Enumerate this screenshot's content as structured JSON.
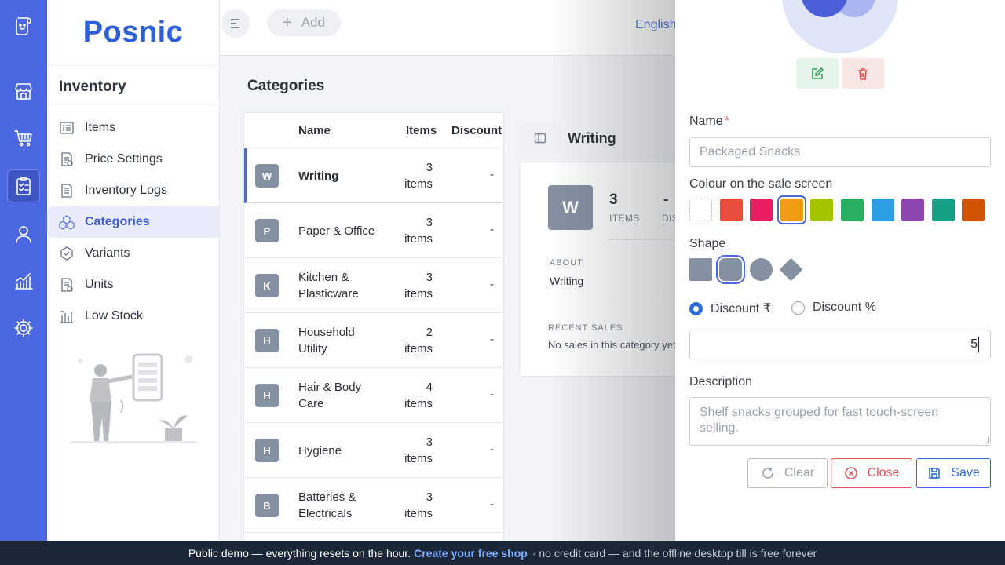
{
  "brand": "Posnic",
  "rail": [
    "store-icon",
    "cart-icon",
    "inventory-icon",
    "user-icon",
    "reports-icon",
    "settings-icon"
  ],
  "sidebar": {
    "title": "Inventory",
    "items": [
      {
        "label": "Items",
        "icon": "items-icon"
      },
      {
        "label": "Price Settings",
        "icon": "price-settings-icon"
      },
      {
        "label": "Inventory Logs",
        "icon": "inventory-logs-icon"
      },
      {
        "label": "Categories",
        "icon": "categories-icon",
        "active": true
      },
      {
        "label": "Variants",
        "icon": "variants-icon"
      },
      {
        "label": "Units",
        "icon": "units-icon"
      },
      {
        "label": "Low Stock",
        "icon": "low-stock-icon"
      }
    ]
  },
  "topbar": {
    "add_label": "Add",
    "language": "English"
  },
  "page": {
    "title": "Categories"
  },
  "table": {
    "headers": {
      "name": "Name",
      "items": "Items",
      "discount": "Discount"
    },
    "rows": [
      {
        "badge": "W",
        "name": "Writing",
        "count": "3",
        "unit": "items",
        "discount": "-",
        "selected": true
      },
      {
        "badge": "P",
        "name": "Paper & Office",
        "count": "3",
        "unit": "items",
        "discount": "-"
      },
      {
        "badge": "K",
        "name": "Kitchen & Plasticware",
        "count": "3",
        "unit": "items",
        "discount": "-"
      },
      {
        "badge": "H",
        "name": "Household Utility",
        "count": "2",
        "unit": "items",
        "discount": "-"
      },
      {
        "badge": "H",
        "name": "Hair & Body Care",
        "count": "4",
        "unit": "items",
        "discount": "-"
      },
      {
        "badge": "H",
        "name": "Hygiene",
        "count": "3",
        "unit": "items",
        "discount": "-"
      },
      {
        "badge": "B",
        "name": "Batteries & Electricals",
        "count": "3",
        "unit": "items",
        "discount": "-"
      }
    ]
  },
  "detail": {
    "title": "Writing",
    "badge": "W",
    "stat_items_value": "3",
    "stat_items_label": "ITEMS",
    "stat_discount_value": "-",
    "stat_discount_label": "DIS",
    "about_label": "ABOUT",
    "about_value": "Writing",
    "recent_label": "RECENT SALES",
    "recent_value": "No sales in this category yet"
  },
  "form": {
    "name_label": "Name",
    "required_mark": "*",
    "name_placeholder": "Packaged Snacks",
    "colour_label": "Colour on the sale screen",
    "colours": [
      "#ffffff",
      "#e74c3c",
      "#e91e63",
      "#f39c12",
      "#a4c400",
      "#27ae60",
      "#2d9fe0",
      "#8e44ad",
      "#16a085",
      "#d35400"
    ],
    "selected_colour_index": 3,
    "shape_label": "Shape",
    "shapes": [
      "square",
      "rounded",
      "circle",
      "diamond"
    ],
    "selected_shape": "rounded",
    "discount_fixed_label": "Discount ₹",
    "discount_percent_label": "Discount %",
    "discount_mode": "fixed",
    "discount_value": "5",
    "description_label": "Description",
    "description_placeholder": "Shelf snacks grouped for fast touch-screen selling.",
    "clear_label": "Clear",
    "close_label": "Close",
    "save_label": "Save"
  },
  "footer": {
    "text": "Public demo — everything resets on the hour.",
    "link": "Create your free shop",
    "tail": "· no credit card — and the offline desktop till is free forever"
  },
  "colors": {
    "accent": "#4c68e0",
    "brand": "#2f5fd8",
    "danger": "#e05656",
    "success": "#2fa35a",
    "footer_bg": "#1b2738"
  }
}
